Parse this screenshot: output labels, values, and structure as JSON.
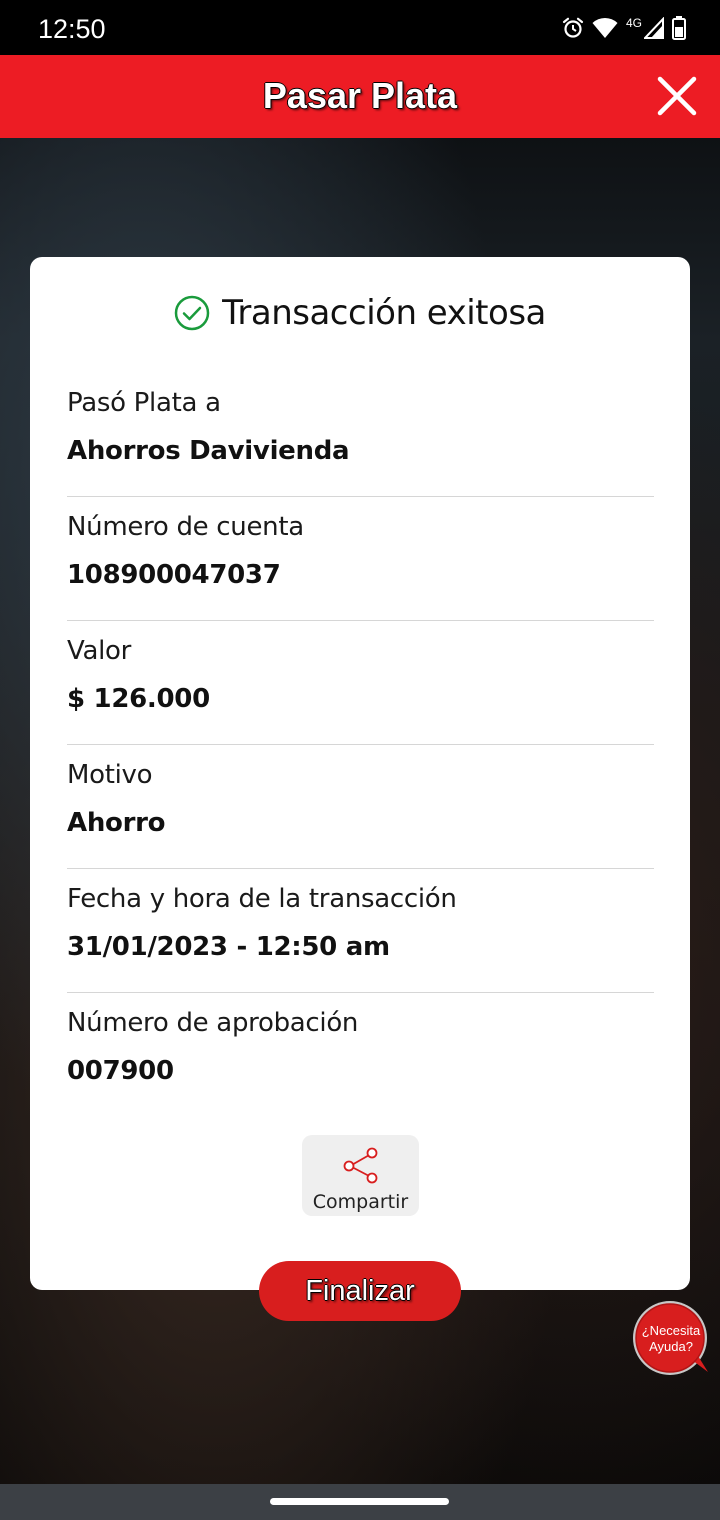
{
  "status_bar": {
    "time": "12:50",
    "network": "4G",
    "icons": [
      "alarm-icon",
      "wifi-icon",
      "signal-icon",
      "battery-icon"
    ]
  },
  "header": {
    "title": "Pasar Plata",
    "close_icon": "close-icon",
    "background_color": "#ed1c24"
  },
  "result": {
    "title": "Transacción exitosa",
    "status_icon": "check-circle-icon",
    "status_color": "#1a9b3c"
  },
  "details": [
    {
      "label": "Pasó Plata a",
      "value": "Ahorros Davivienda"
    },
    {
      "label": "Número de cuenta",
      "value": "108900047037"
    },
    {
      "label": "Valor",
      "value": "$ 126.000"
    },
    {
      "label": "Motivo",
      "value": "Ahorro"
    },
    {
      "label": "Fecha y hora de la transacción",
      "value": "31/01/2023 - 12:50 am"
    },
    {
      "label": "Número de aprobación",
      "value": "007900"
    }
  ],
  "actions": {
    "share_label": "Compartir",
    "share_icon": "share-icon",
    "finish_label": "Finalizar",
    "accent_color": "#d81e1e"
  },
  "help": {
    "line1": "¿Necesita",
    "line2": "Ayuda?"
  }
}
